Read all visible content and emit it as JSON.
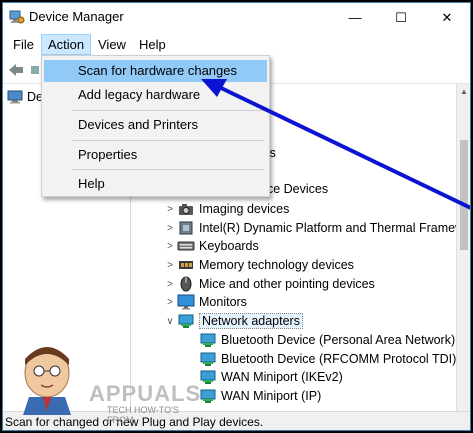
{
  "window": {
    "title": "Device Manager"
  },
  "controls": {
    "minimize": "—",
    "maximize": "☐",
    "close": "✕"
  },
  "menubar": {
    "file": "File",
    "action": "Action",
    "view": "View",
    "help": "Help"
  },
  "action_menu": {
    "items": [
      {
        "label": "Scan for hardware changes",
        "highlighted": true
      },
      {
        "label": "Add legacy hardware"
      },
      {
        "label": "Devices and Printers"
      },
      {
        "label": "Properties"
      },
      {
        "label": "Help"
      }
    ]
  },
  "left_pane": {
    "root_label": "De"
  },
  "tree": {
    "partial_1": "ters",
    "partial_2": "ace Devices",
    "categories": [
      {
        "label": "Imaging devices",
        "icon": "camera-icon"
      },
      {
        "label": "Intel(R) Dynamic Platform and Thermal Framewor",
        "icon": "chip-icon"
      },
      {
        "label": "Keyboards",
        "icon": "keyboard-icon"
      },
      {
        "label": "Memory technology devices",
        "icon": "memory-icon"
      },
      {
        "label": "Mice and other pointing devices",
        "icon": "mouse-icon"
      },
      {
        "label": "Monitors",
        "icon": "monitor-icon"
      },
      {
        "label": "Network adapters",
        "icon": "network-icon",
        "expanded": true
      }
    ],
    "network_children": [
      "Bluetooth Device (Personal Area Network)",
      "Bluetooth Device (RFCOMM Protocol TDI)",
      "WAN Miniport (IKEv2)",
      "WAN Miniport (IP)"
    ]
  },
  "status": {
    "text": "Scan for changed or new Plug and Play devices."
  },
  "watermark": {
    "title": "APPUALS",
    "subtitle": "TECH HOW-TO'S FROM"
  },
  "colors": {
    "accent": "#0a14d2",
    "highlight": "#91c9f7",
    "menu_active": "#cce8ff"
  }
}
